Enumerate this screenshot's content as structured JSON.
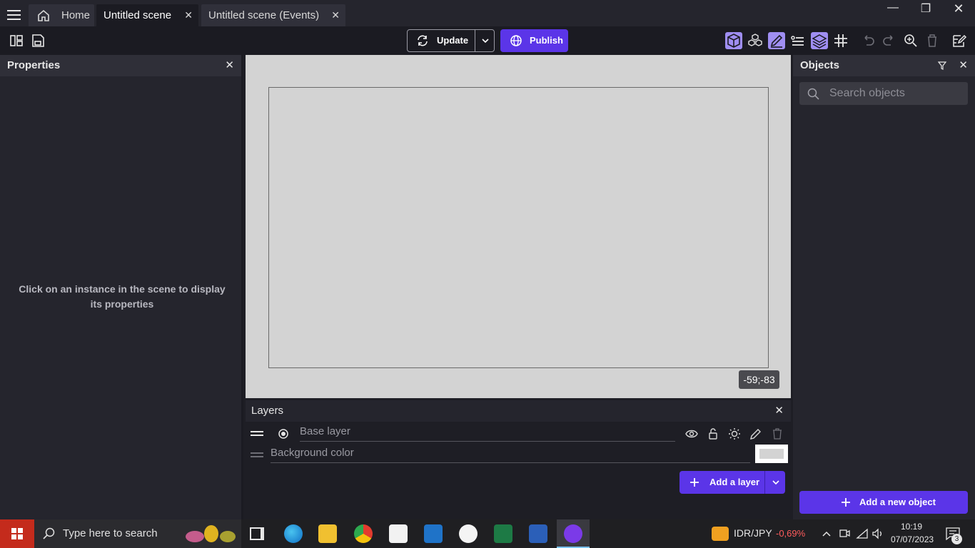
{
  "titlebar": {
    "tabs": [
      {
        "label": "Home"
      },
      {
        "label": "Untitled scene"
      },
      {
        "label": "Untitled scene (Events)"
      }
    ]
  },
  "toolbar": {
    "update_label": "Update",
    "publish_label": "Publish"
  },
  "properties": {
    "title": "Properties",
    "empty_message": "Click on an instance in the scene to display its properties"
  },
  "canvas": {
    "coords": "-59;-83"
  },
  "layers": {
    "title": "Layers",
    "base_layer": "Base layer",
    "background_color": "Background color",
    "add_layer_label": "Add a layer"
  },
  "objects": {
    "title": "Objects",
    "search_placeholder": "Search objects",
    "add_object_label": "Add a new object"
  },
  "taskbar": {
    "search_placeholder": "Type here to search",
    "ticker_symbol": "IDR/JPY",
    "ticker_change": "-0,69%",
    "time": "10:19",
    "date": "07/07/2023",
    "notification_count": "3"
  },
  "colors": {
    "accent": "#5b35e8",
    "active_tool": "#9f8ef2",
    "canvas_bg": "#d3d3d3",
    "ticker_negative": "#ff5c5c"
  }
}
